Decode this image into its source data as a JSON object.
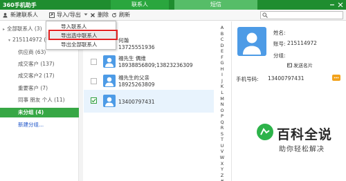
{
  "app": {
    "title": "360手机助手"
  },
  "tabs": {
    "contacts": "联系人",
    "sms": "短信"
  },
  "toolbar": {
    "new_contact": "新建联系人",
    "import_export": "导入/导出",
    "delete": "删除",
    "refresh": "刷新",
    "search_placeholder": ""
  },
  "menu": {
    "items": [
      "导入联系人",
      "导出选中联系人",
      "导出全部联系人"
    ],
    "highlighted_index": 1
  },
  "sidebar": {
    "items": [
      {
        "label": "全部联系人 (3)"
      },
      {
        "label": "215114972 (3)"
      },
      {
        "label": "供应商 (63)"
      },
      {
        "label": "成交客户 (137)"
      },
      {
        "label": "成交客户2 (17)"
      },
      {
        "label": "重要客户 (7)"
      },
      {
        "label": "同事 朋友 个人 (11)"
      },
      {
        "label": "未分组 (4)"
      },
      {
        "label": "新建分组..."
      }
    ],
    "selected_index": 7
  },
  "contacts": [
    {
      "name": "何瀚",
      "phone": "13725551936",
      "checked": false
    },
    {
      "name": "福先生 偶维",
      "phone": "18938856809;13823236309",
      "checked": false
    },
    {
      "name": "福先生的父亲",
      "phone": "18925263809",
      "checked": false
    },
    {
      "name": "",
      "phone": "13400797431",
      "checked": true
    }
  ],
  "alphabet": [
    "A",
    "B",
    "C",
    "D",
    "E",
    "F",
    "G",
    "H",
    "I",
    "J",
    "K",
    "L",
    "M",
    "N",
    "O",
    "P",
    "Q",
    "R",
    "S",
    "T",
    "U",
    "V",
    "W",
    "X",
    "Y",
    "Z",
    "#"
  ],
  "detail": {
    "name_label": "姓名:",
    "account_label": "账号:",
    "account_value": "215114972",
    "group_label": "分组:",
    "send_card": "发送名片",
    "phone_label": "手机号码:",
    "phone_value": "13400797431"
  },
  "watermark": {
    "title": "百科全说",
    "subtitle": "助你轻松解决"
  },
  "colors": {
    "title_bar": "#1f8d2f",
    "selected_group": "#37a745",
    "avatar": "#4d9be6",
    "highlight_border": "#e32222",
    "link": "#1f56c9"
  },
  "icons": {
    "new_contact": "add-user-icon",
    "import_export": "import-export-icon",
    "delete": "delete-icon",
    "refresh": "refresh-icon",
    "search": "search-icon",
    "send_card": "card-icon",
    "message": "message-icon"
  }
}
